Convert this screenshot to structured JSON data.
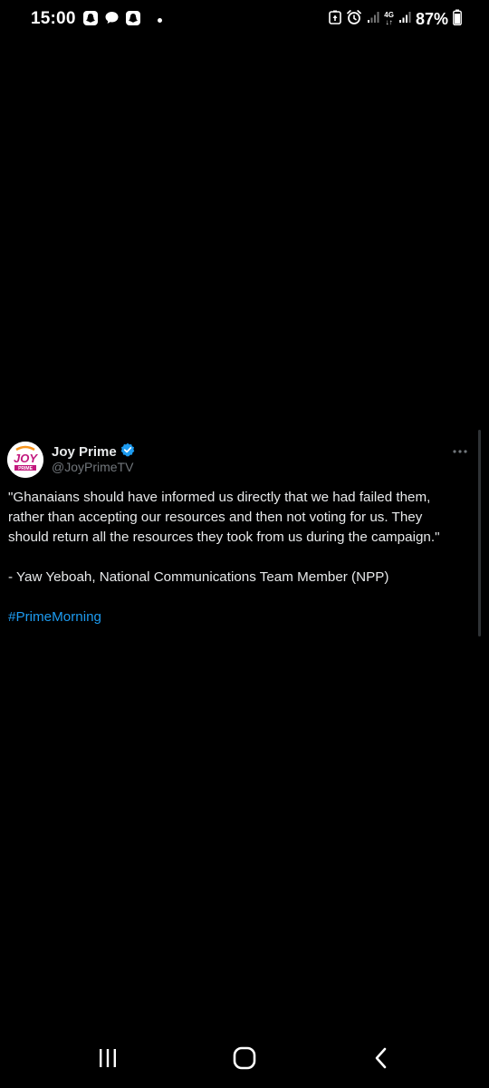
{
  "status_bar": {
    "time": "15:00",
    "network_label_top": "4G",
    "network_label_bottom": "↓↑",
    "battery_percent": "87%"
  },
  "tweet": {
    "author": {
      "display_name": "Joy Prime",
      "handle": "@JoyPrimeTV",
      "verified": true,
      "avatar_text": "JOY",
      "avatar_sub_text": "PRIME"
    },
    "body": {
      "quote": "\"Ghanaians should have informed us directly that we had failed them, rather than accepting our resources and then not voting for us. They should return all the resources they took from us during the campaign.\"",
      "attribution": "- Yaw Yeboah, National Communications Team Member (NPP)",
      "hashtag": "#PrimeMorning"
    }
  },
  "colors": {
    "background": "#000000",
    "text_primary": "#e7e9ea",
    "text_secondary": "#71767b",
    "link": "#1d9bf0",
    "verified_badge": "#1d9bf0",
    "brand_magenta": "#c2187d",
    "brand_orange": "#f7941d"
  },
  "icons": {
    "status_notifications": [
      "snapchat-icon",
      "chat-bubble-icon",
      "snapchat-icon"
    ],
    "status_right": [
      "data-saver-icon",
      "alarm-icon",
      "signal-icon",
      "signal-icon",
      "battery-icon"
    ],
    "tweet": [
      "verified-badge-icon",
      "more-options-icon"
    ],
    "nav": [
      "recent-apps-icon",
      "home-icon",
      "back-icon"
    ]
  }
}
